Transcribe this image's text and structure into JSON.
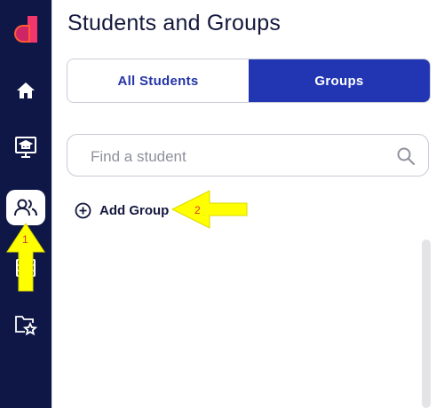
{
  "page": {
    "title": "Students and Groups"
  },
  "sidebar": {
    "items": [
      {
        "icon": "home-icon"
      },
      {
        "icon": "classroom-icon"
      },
      {
        "icon": "users-icon",
        "active": true
      },
      {
        "icon": "calendar-icon"
      },
      {
        "icon": "folder-star-icon"
      }
    ]
  },
  "tabs": [
    {
      "label": "All Students",
      "active": false
    },
    {
      "label": "Groups",
      "active": true
    }
  ],
  "search": {
    "placeholder": "Find a student",
    "value": ""
  },
  "actions": {
    "add_group_label": "Add Group"
  },
  "annotations": [
    {
      "number": "1",
      "color": "#ffff00"
    },
    {
      "number": "2",
      "color": "#ffff00"
    }
  ],
  "colors": {
    "sidebar": "#0f1747",
    "accent": "#2236b4",
    "annotation_arrow": "#ffff00"
  }
}
